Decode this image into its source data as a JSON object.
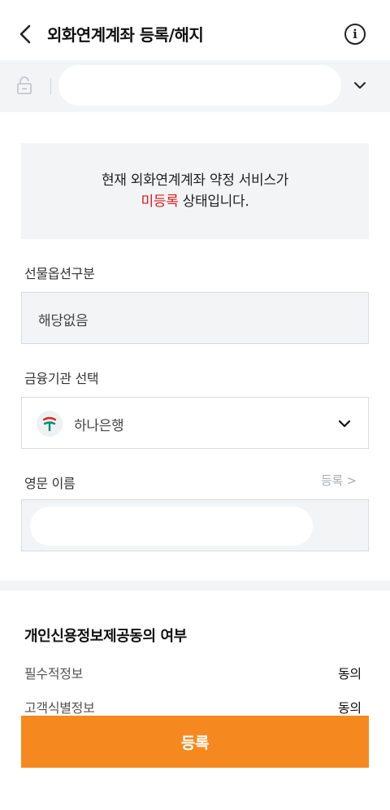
{
  "header": {
    "title": "외화연계계좌 등록/해지",
    "info_symbol": "i"
  },
  "status": {
    "line1": "현재 외화연계계좌 약정 서비스가",
    "line2_status": "미등록",
    "line2_suffix": " 상태입니다.",
    "status_color": "#d7191c"
  },
  "futures": {
    "label": "선물옵션구분",
    "value": "해당없음"
  },
  "bank": {
    "label": "금융기관 선택",
    "selected": "하나은행",
    "brand_color": "#008c73"
  },
  "english_name": {
    "label": "영문 이름",
    "register_link": "등록 >"
  },
  "consent": {
    "title": "개인신용정보제공동의 여부",
    "rows": [
      {
        "label": "필수적정보",
        "value": "동의"
      },
      {
        "label": "고객식별정보",
        "value": "동의"
      }
    ]
  },
  "submit": {
    "label": "등록",
    "color": "#f5891f"
  }
}
